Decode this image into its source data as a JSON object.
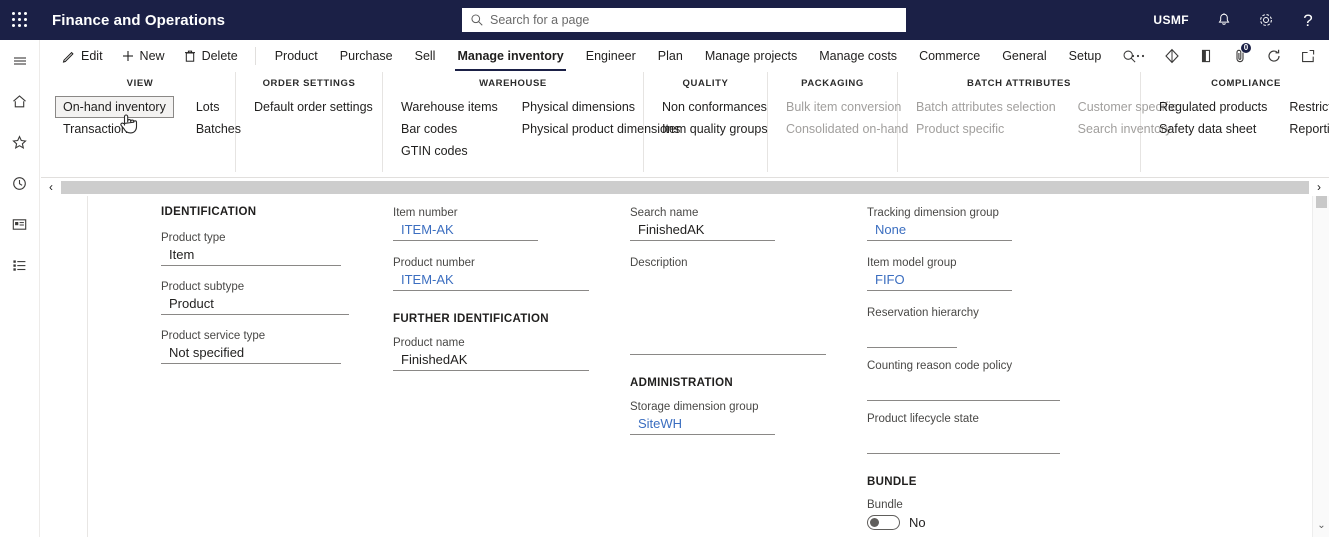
{
  "topbar": {
    "waffle_label": "app-launcher",
    "app_title": "Finance and Operations",
    "search_placeholder": "Search for a page",
    "company": "USMF",
    "icons": [
      "bell-icon",
      "gear-icon",
      "help-icon"
    ]
  },
  "rail": {
    "items": [
      {
        "name": "hamburger-menu-icon",
        "label": "Expand the navigation pane"
      },
      {
        "name": "home-icon",
        "label": "Home"
      },
      {
        "name": "star-icon",
        "label": "Favorites"
      },
      {
        "name": "clock-icon",
        "label": "Recent"
      },
      {
        "name": "workspaces-icon",
        "label": "Workspaces"
      },
      {
        "name": "modules-icon",
        "label": "Modules"
      }
    ]
  },
  "actionpane": {
    "commands": [
      {
        "label": "Edit",
        "icon": "pencil-icon"
      },
      {
        "label": "New",
        "icon": "plus-icon"
      },
      {
        "label": "Delete",
        "icon": "trash-icon"
      }
    ],
    "tabs": [
      {
        "label": "Product",
        "active": false
      },
      {
        "label": "Purchase",
        "active": false
      },
      {
        "label": "Sell",
        "active": false
      },
      {
        "label": "Manage inventory",
        "active": true
      },
      {
        "label": "Engineer",
        "active": false
      },
      {
        "label": "Plan",
        "active": false
      },
      {
        "label": "Manage projects",
        "active": false
      },
      {
        "label": "Manage costs",
        "active": false
      },
      {
        "label": "Commerce",
        "active": false
      },
      {
        "label": "General",
        "active": false
      },
      {
        "label": "Setup",
        "active": false
      }
    ],
    "tab_search_icon": "search-icon",
    "right_icons": [
      {
        "name": "overflow-ellipsis-icon",
        "badge": null
      },
      {
        "name": "share-icon",
        "badge": null
      },
      {
        "name": "open-in-office-icon",
        "badge": null
      },
      {
        "name": "attachments-icon",
        "badge": "0"
      },
      {
        "name": "refresh-icon",
        "badge": null
      },
      {
        "name": "open-in-new-window-icon",
        "badge": null
      }
    ],
    "groups": [
      {
        "title": "View",
        "columns": [
          [
            {
              "label": "On-hand inventory",
              "state": "selected"
            },
            {
              "label": "Transactions",
              "state": "enabled"
            }
          ],
          [
            {
              "label": "Lots",
              "state": "enabled"
            },
            {
              "label": "Batches",
              "state": "enabled"
            }
          ]
        ]
      },
      {
        "title": "Order settings",
        "columns": [
          [
            {
              "label": "Default order settings",
              "state": "enabled"
            }
          ]
        ]
      },
      {
        "title": "Warehouse",
        "columns": [
          [
            {
              "label": "Warehouse items",
              "state": "enabled"
            },
            {
              "label": "Bar codes",
              "state": "enabled"
            },
            {
              "label": "GTIN codes",
              "state": "enabled"
            }
          ],
          [
            {
              "label": "Physical dimensions",
              "state": "enabled"
            },
            {
              "label": "Physical product dimensions",
              "state": "enabled"
            }
          ]
        ]
      },
      {
        "title": "Quality",
        "columns": [
          [
            {
              "label": "Non conformances",
              "state": "enabled"
            },
            {
              "label": "Item quality groups",
              "state": "enabled"
            }
          ]
        ]
      },
      {
        "title": "Packaging",
        "columns": [
          [
            {
              "label": "Bulk item conversion",
              "state": "disabled"
            },
            {
              "label": "Consolidated on-hand",
              "state": "disabled"
            }
          ]
        ]
      },
      {
        "title": "Batch attributes",
        "columns": [
          [
            {
              "label": "Batch attributes selection",
              "state": "disabled"
            },
            {
              "label": "Product specific",
              "state": "disabled"
            }
          ],
          [
            {
              "label": "Customer specific",
              "state": "disabled"
            },
            {
              "label": "Search inventory",
              "state": "disabled"
            }
          ]
        ]
      },
      {
        "title": "Compliance",
        "columns": [
          [
            {
              "label": "Regulated products",
              "state": "enabled"
            },
            {
              "label": "Safety data sheet",
              "state": "enabled"
            }
          ],
          [
            {
              "label": "Restricted products",
              "state": "enabled"
            },
            {
              "label": "Reporting details",
              "state": "enabled"
            }
          ]
        ]
      }
    ]
  },
  "hscroll": {
    "left_arrow": "‹",
    "right_arrow": "›"
  },
  "vscroll": {
    "down_chevron": "⌄"
  },
  "form": {
    "col1": {
      "section": "IDENTIFICATION",
      "fields": [
        {
          "label": "Product type",
          "value": "Item",
          "style": "text"
        },
        {
          "label": "Product subtype",
          "value": "Product",
          "style": "text"
        },
        {
          "label": "Product service type",
          "value": "Not specified",
          "style": "text"
        }
      ]
    },
    "col2": {
      "fields": [
        {
          "label": "Item number",
          "value": "ITEM-AK",
          "style": "link"
        },
        {
          "label": "Product number",
          "value": "ITEM-AK",
          "style": "link"
        }
      ],
      "section2": "FURTHER IDENTIFICATION",
      "fields2": [
        {
          "label": "Product name",
          "value": "FinishedAK",
          "style": "text"
        }
      ]
    },
    "col3": {
      "fields": [
        {
          "label": "Search name",
          "value": "FinishedAK",
          "style": "text"
        },
        {
          "label": "Description",
          "value": "",
          "style": "text"
        }
      ],
      "section2": "ADMINISTRATION",
      "fields2": [
        {
          "label": "Storage dimension group",
          "value": "SiteWH",
          "style": "link"
        }
      ]
    },
    "col4": {
      "fields": [
        {
          "label": "Tracking dimension group",
          "value": "None",
          "style": "link"
        },
        {
          "label": "Item model group",
          "value": "FIFO",
          "style": "link"
        },
        {
          "label": "Reservation hierarchy",
          "value": "",
          "style": "text"
        },
        {
          "label": "Counting reason code policy",
          "value": "",
          "style": "text"
        },
        {
          "label": "Product lifecycle state",
          "value": "",
          "style": "text"
        }
      ],
      "section2": "BUNDLE",
      "toggle": {
        "label": "Bundle",
        "value": "No",
        "on": false
      }
    }
  },
  "colors": {
    "navy": "#1b2046",
    "link": "#3b6ec0",
    "disabled": "#a19f9d"
  }
}
